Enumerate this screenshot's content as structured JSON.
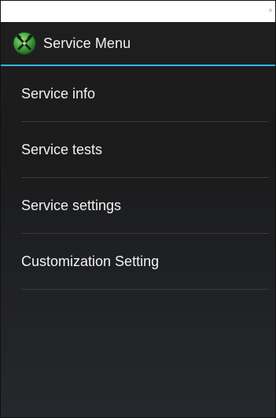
{
  "action_bar": {
    "title": "Service Menu",
    "icon": "crossed-tools-app-icon",
    "accent_color": "#33b5e5"
  },
  "menu": {
    "items": [
      {
        "label": "Service info"
      },
      {
        "label": "Service tests"
      },
      {
        "label": "Service settings"
      },
      {
        "label": "Customization Setting"
      }
    ]
  }
}
